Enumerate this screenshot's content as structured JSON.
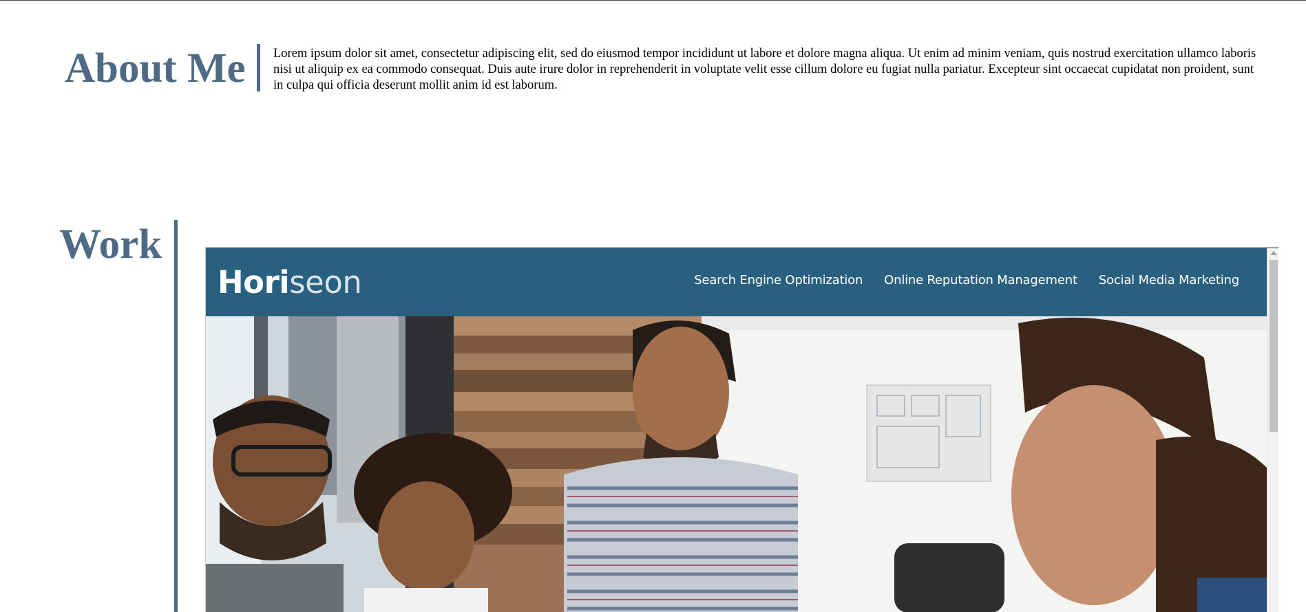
{
  "about": {
    "heading": "About Me",
    "text": "Lorem ipsum dolor sit amet, consectetur adipiscing elit, sed do eiusmod tempor incididunt ut labore et dolore magna aliqua. Ut enim ad minim veniam, quis nostrud exercitation ullamco laboris nisi ut aliquip ex ea commodo consequat. Duis aute irure dolor in reprehenderit in voluptate velit esse cillum dolore eu fugiat nulla pariatur. Excepteur sint occaecat cupidatat non proident, sunt in culpa qui officia deserunt mollit anim id est laborum."
  },
  "work": {
    "heading": "Work",
    "site": {
      "logo_primary": "Hori",
      "logo_accent": "seon",
      "nav": [
        "Search Engine Optimization",
        "Online Reputation Management",
        "Social Media Marketing"
      ],
      "header_color": "#2a607f"
    }
  },
  "colors": {
    "accent": "#4e6a84"
  }
}
